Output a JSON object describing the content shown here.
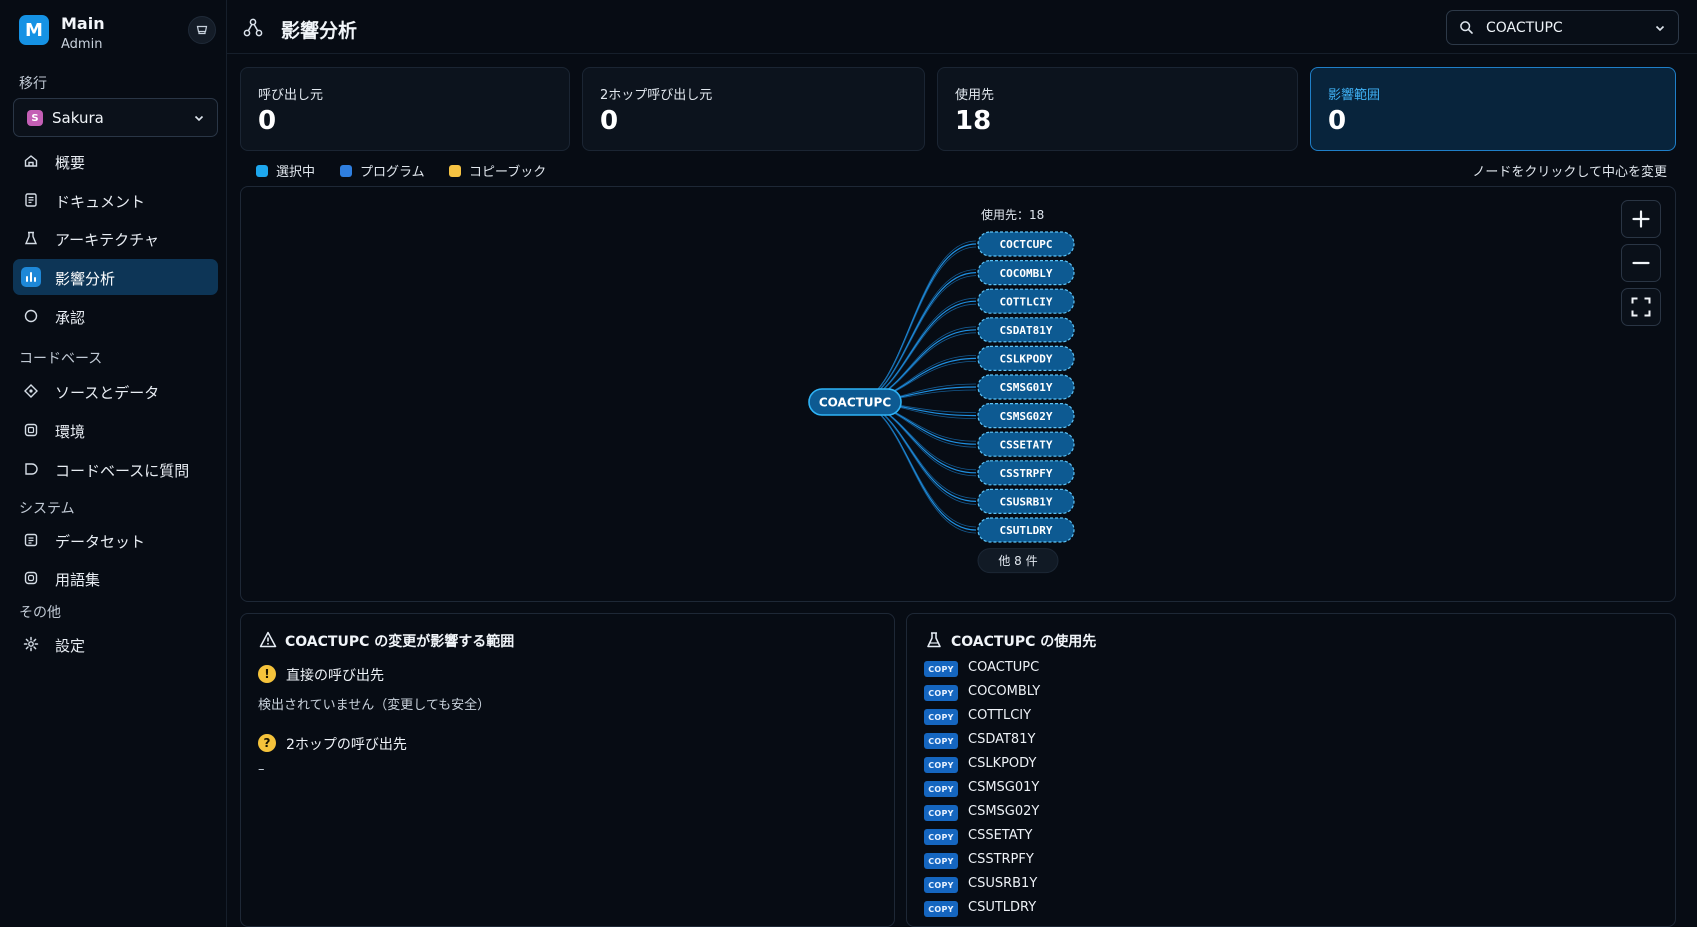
{
  "app": {
    "logo_letter": "M",
    "name": "Main",
    "role": "Admin"
  },
  "sidebar": {
    "migration_label": "移行",
    "project": {
      "badge": "S",
      "name": "Sakura"
    },
    "items_migration": [
      {
        "label": "概要",
        "icon": "home-icon"
      },
      {
        "label": "ドキュメント",
        "icon": "document-icon"
      },
      {
        "label": "アーキテクチャ",
        "icon": "architecture-icon"
      },
      {
        "label": "影響分析",
        "icon": "impact-analysis-icon",
        "active": true
      },
      {
        "label": "承認",
        "icon": "circle-icon"
      }
    ],
    "codebase_label": "コードベース",
    "items_codebase": [
      {
        "label": "ソースとデータ",
        "icon": "source-data-icon"
      },
      {
        "label": "環境",
        "icon": "environment-icon"
      },
      {
        "label": "コードベースに質問",
        "icon": "chat-icon"
      }
    ],
    "system_label": "システム",
    "items_system": [
      {
        "label": "データセット",
        "icon": "dataset-icon"
      },
      {
        "label": "用語集",
        "icon": "glossary-icon"
      }
    ],
    "other_label": "その他",
    "items_other": [
      {
        "label": "設定",
        "icon": "gear-icon"
      }
    ]
  },
  "header": {
    "title": "影響分析"
  },
  "search": {
    "value": "COACTUPC"
  },
  "stats": [
    {
      "label": "呼び出し元",
      "value": "0"
    },
    {
      "label": "2ホップ呼び出し元",
      "value": "0"
    },
    {
      "label": "使用先",
      "value": "18"
    },
    {
      "label": "影響範囲",
      "value": "0"
    }
  ],
  "legend": [
    {
      "label": "選択中",
      "color": "#1da7ee"
    },
    {
      "label": "プログラム",
      "color": "#2f7fe0"
    },
    {
      "label": "コピーブック",
      "color": "#f6c343"
    }
  ],
  "hint": "ノードをクリックして中心を変更",
  "graph": {
    "center": "COACTUPC",
    "targets_label": "使用先：18",
    "targets": [
      "COCTCUPC",
      "COCOMBLY",
      "COTTLCIY",
      "CSDAT81Y",
      "CSLKPODY",
      "CSMSG01Y",
      "CSMSG02Y",
      "CSSETATY",
      "CSSTRPFY",
      "CSUSRB1Y",
      "CSUTLDRY"
    ],
    "more": "他 8 件"
  },
  "impact_panel": {
    "title": "COACTUPC の変更が影響する範囲",
    "direct_heading": "直接の呼び出先",
    "direct_note": "検出されていません（変更しても安全）",
    "twohop_heading": "2ホップの呼び出先",
    "twohop_note": "–"
  },
  "usage_panel": {
    "title": "COACTUPC の使用先",
    "badge": "COPY",
    "items": [
      "COACTUPC",
      "COCOMBLY",
      "COTTLCIY",
      "CSDAT81Y",
      "CSLKPODY",
      "CSMSG01Y",
      "CSMSG02Y",
      "CSSETATY",
      "CSSTRPFY",
      "CSUSRB1Y",
      "CSUTLDRY"
    ]
  }
}
